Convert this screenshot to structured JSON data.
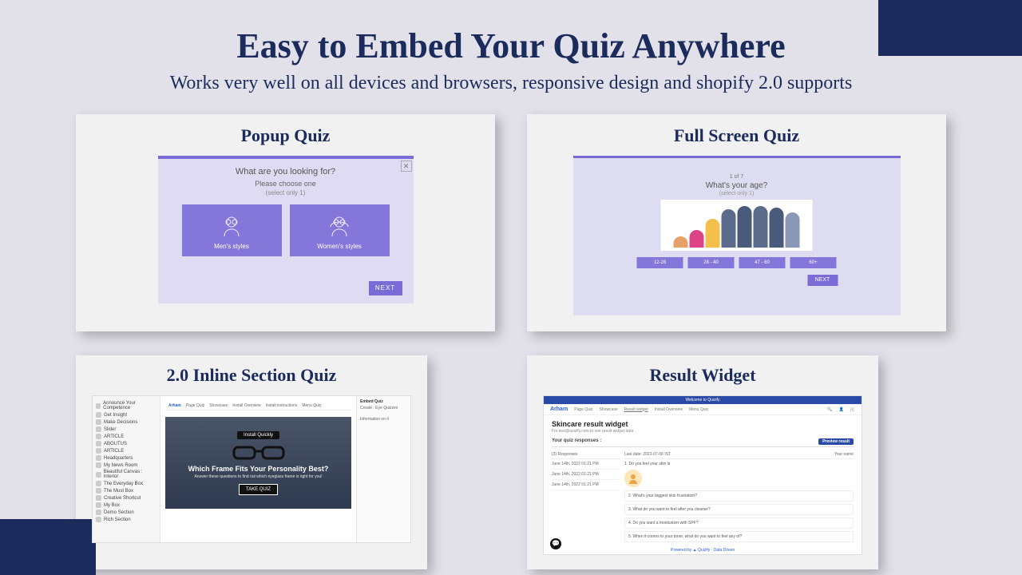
{
  "headline": "Easy to Embed Your Quiz Anywhere",
  "subhead": "Works very well on all devices and browsers, responsive design and shopify 2.0 supports",
  "cards": {
    "popup": {
      "title": "Popup Quiz",
      "question": "What are you looking for?",
      "instruction": "Please choose one",
      "select_hint": "(select only 1)",
      "options": [
        "Men's styles",
        "Women's styles"
      ],
      "next": "NEXT"
    },
    "fullscreen": {
      "title": "Full Screen Quiz",
      "step": "1 of 7",
      "question": "What's your age?",
      "select_hint": "(select only 1)",
      "options": [
        "12-28",
        "28 - 40",
        "47 - 60",
        "60+"
      ],
      "next": "NEXT"
    },
    "inline": {
      "title": "2.0 Inline Section Quiz",
      "brand": "Arham",
      "nav": [
        "Page Quiz",
        "Showcase",
        "Install Overview",
        "Install instructions",
        "Menu Quiz"
      ],
      "store_pill": "Install Quickly",
      "hero_title": "Which Frame Fits Your Personality Best?",
      "hero_sub": "Answer these questions to find out which eyeglass frame is right for you!",
      "take_quiz": "TAKE QUIZ",
      "side_items": [
        "Announce Your Competence",
        "Get Insight",
        "Make Decisions",
        "Slider",
        "ARTICLE",
        "ABOUTUS",
        "ARTICLE",
        "Headquarters",
        "My News Room",
        "Beautiful Canvas : Interior",
        "The Everyday Box",
        "The Must Box",
        "Creative Shortcut",
        "My Box",
        "Demo Section",
        "Rich Section"
      ],
      "right_head": "Embed Quiz",
      "right_sub": "Create : Eye Quizzes",
      "right_info": "Information on it"
    },
    "result": {
      "title": "Result Widget",
      "topbar": "Welcome to Quizify",
      "brand": "Arham",
      "nav": [
        "Page Quiz",
        "Showcase",
        "Result widget",
        "Install Overview",
        "Menu Quiz"
      ],
      "widget_title": "Skincare result widget",
      "email_line": "For test@quizify.com to see result widget data",
      "responses_label": "Your quiz responses :",
      "preview": "Preview result",
      "table_head_left": "(3) Responses",
      "table_head_date": "Last date: 2022-07-06 IST",
      "rows": [
        "June 14th, 2022 01:21 PM",
        "June 14th, 2022 01:21 PM",
        "June 14th, 2022 01:21 PM"
      ],
      "right_head": "1. Do you feel your skin is",
      "right_head2": "Your name",
      "questions": [
        "2. What's your biggest skin frustration?",
        "3. What do you want to feel after you cleanse?",
        "4. Do you want a moisturizer with SPF?",
        "5. When it comes to your toner, what do you want to feel any of?"
      ],
      "footer": "Powered by ▲ Quizify · Data Driven"
    }
  }
}
